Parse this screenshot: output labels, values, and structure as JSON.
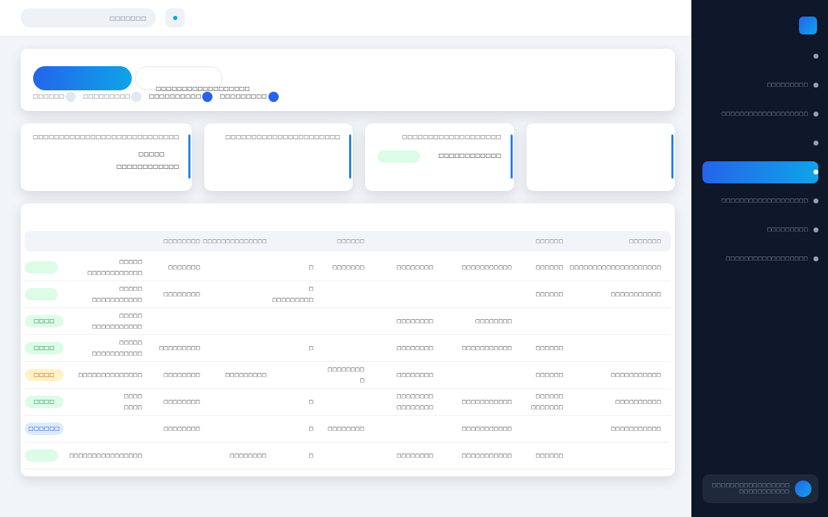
{
  "header": {
    "search": {
      "placeholder": "□□□□□□□"
    },
    "notification": {
      "unread": true
    }
  },
  "toolbar": {
    "buttons": [
      {
        "kind": "primary"
      },
      {
        "kind": "outline"
      }
    ],
    "caption": "□□□□□□□□□□□□□□□□□□",
    "filters": [
      {
        "label": "□□□□□□",
        "selected": false
      },
      {
        "label": "□□□□□□□□□",
        "selected": false
      },
      {
        "label": "□□□□□□□□□□",
        "selected": true
      },
      {
        "label": "□□□□□□□□□",
        "selected": true
      }
    ]
  },
  "stats": [
    {
      "title": "□□□□□□□□□□□□□□□□□□□□□□□□□□□□",
      "value": "□□□□□",
      "sub": "□□□□□□□□□□□□",
      "pill": false
    },
    {
      "title": "□□□□□□□□□□□□□□□□□□□□□□",
      "pill": false
    },
    {
      "title": "□□□□□□□□□□□□□□□□□□□",
      "sub": "□□□□□□□□□□□□",
      "pill": true
    },
    {
      "pill": false
    }
  ],
  "table": {
    "columns": [
      {},
      {
        "label": "□□□□□□□□"
      },
      {
        "label": "□□□□□□□□□□□□□□"
      },
      {},
      {
        "label": "□□□□□□"
      },
      {},
      {},
      {
        "label": "□□□□□□"
      },
      {
        "label": "□□□□□□□"
      }
    ],
    "rows": [
      {
        "status": {
          "kind": "success"
        },
        "cells": [
          [
            "□□□□□",
            "□□□□□□□□□□□□"
          ],
          "□□□□□□□",
          null,
          "□",
          "□□□□□□□",
          "□□□□□□□□",
          "□□□□□□□□□□□",
          "□□□□□□",
          "□□□□□□□□□□□□□□□□□□□□"
        ]
      },
      {
        "status": {
          "kind": "success"
        },
        "cells": [
          [
            "□□□□□",
            "□□□□□□□□□□□"
          ],
          "□□□□□□□□",
          null,
          [
            "□",
            "□□□□□□□□□"
          ],
          null,
          null,
          null,
          "□□□□□□",
          "□□□□□□□□□□□"
        ]
      },
      {
        "status": {
          "kind": "success",
          "text": "□□□□"
        },
        "cells": [
          [
            "□□□□□",
            "□□□□□□□□□□□"
          ],
          null,
          null,
          null,
          null,
          "□□□□□□□□",
          "□□□□□□□□",
          null,
          null
        ]
      },
      {
        "status": {
          "kind": "success",
          "text": "□□□□"
        },
        "cells": [
          [
            "□□□□□",
            "□□□□□□□□□□□"
          ],
          "□□□□□□□□□",
          null,
          "□",
          null,
          "□□□□□□□□",
          "□□□□□□□□□□□",
          "□□□□□□",
          null
        ]
      },
      {
        "status": {
          "kind": "warning",
          "text": "□□□□"
        },
        "cells": [
          "□□□□□□□□□□□□□□",
          "□□□□□□□□",
          "□□□□□□□□□",
          null,
          [
            "□□□□□□□□",
            "□"
          ],
          "□□□□□□□□",
          null,
          "□□□□□□",
          "□□□□□□□□□□□"
        ]
      },
      {
        "status": {
          "kind": "success",
          "text": "□□□□"
        },
        "cells": [
          [
            "□□□□",
            "□□□□"
          ],
          "□□□□□□□□",
          null,
          "□",
          null,
          [
            "□□□□□□□□",
            "□□□□□□□□"
          ],
          "□□□□□□□□□□□",
          [
            "□□□□□□",
            "□□□□□□□"
          ],
          "□□□□□□□□□□"
        ]
      },
      {
        "status": {
          "kind": "info",
          "text": "□□□□□□"
        },
        "cells": [
          null,
          "□□□□□□□□",
          null,
          "□",
          "□□□□□□□□",
          null,
          "□□□□□□□□□□□",
          null,
          "□□□□□□□□□□□"
        ]
      },
      {
        "status": {
          "kind": "success"
        },
        "cells": [
          "□□□□□□□□□□□□□□□□",
          null,
          "□□□□□□□□",
          "□",
          null,
          "□□□□□□□□",
          "□□□□□□□□□□□",
          "□□□□□□",
          null
        ]
      }
    ]
  },
  "sidebar": {
    "items": [
      {
        "selected": false
      },
      {
        "label": "□□□□□□□□□",
        "selected": false
      },
      {
        "label": "□□□□□□□□□□□□□□□□□□□",
        "selected": false
      },
      {
        "selected": false
      },
      {
        "selected": true
      },
      {
        "label": "□□□□□□□□□□□□□□□□□□□",
        "selected": false
      },
      {
        "label": "□□□□□□□□□",
        "selected": false
      },
      {
        "label": "□□□□□□□□□□□□□□□□□□",
        "selected": false
      }
    ],
    "user": {
      "name": "□□□□□□□□□□□□□□□□□□□□□□□□□□□□"
    }
  }
}
